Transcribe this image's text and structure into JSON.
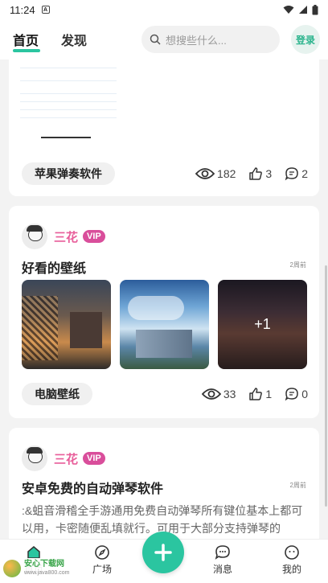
{
  "status_bar": {
    "time": "11:24",
    "notification": "A"
  },
  "header": {
    "tabs": [
      {
        "label": "首页"
      },
      {
        "label": "发现"
      }
    ],
    "search_placeholder": "想搜些什么...",
    "login_label": "登录"
  },
  "posts": [
    {
      "tag": "苹果弹奏软件",
      "views": "182",
      "likes": "3",
      "comments": "2"
    },
    {
      "author": "三花",
      "vip": "VIP",
      "title": "好看的壁纸",
      "time": "2周前",
      "more_images": "+1",
      "tag": "电脑壁纸",
      "views": "33",
      "likes": "1",
      "comments": "0"
    },
    {
      "author": "三花",
      "vip": "VIP",
      "title": "安卓免费的自动弹琴软件",
      "time": "2周前",
      "description": ":&蛆音滑稽全手游通用免费自动弹琴所有键位基本上都可以用，卡密随便乱填就行。可用于大部分支持弹琴的"
    }
  ],
  "bottom_nav": {
    "items": [
      {
        "label": "首页",
        "icon": "home-icon"
      },
      {
        "label": "广场",
        "icon": "compass-icon"
      },
      {
        "label": "消息",
        "icon": "message-icon"
      },
      {
        "label": "我的",
        "icon": "profile-icon"
      }
    ],
    "fab_icon": "plus-icon"
  },
  "watermark": {
    "brand": "安心下载网",
    "url": "www.java800.com"
  },
  "colors": {
    "accent": "#2bc5a0",
    "vip": "#d94e9b",
    "author": "#e85d9a"
  }
}
